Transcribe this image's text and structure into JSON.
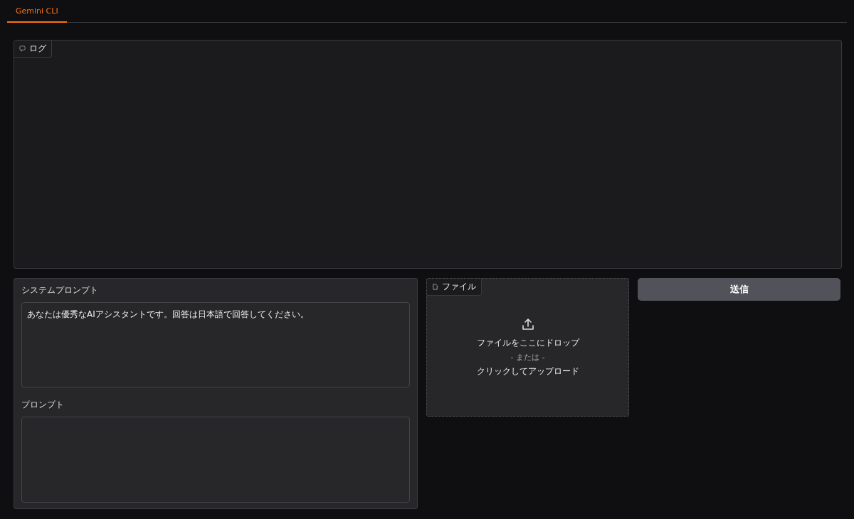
{
  "tabs": [
    {
      "label": "Gemini CLI",
      "selected": true
    }
  ],
  "log": {
    "label": "ログ"
  },
  "system_prompt": {
    "label": "システムプロンプト",
    "value": "あなたは優秀なAIアシスタントです。回答は日本語で回答してください。"
  },
  "prompt": {
    "label": "プロンプト"
  },
  "file_upload": {
    "label": "ファイル",
    "drop_text": "ファイルをここにドロップ",
    "or_text": "- または -",
    "click_text": "クリックしてアップロード"
  },
  "submit_button": {
    "label": "送信"
  }
}
